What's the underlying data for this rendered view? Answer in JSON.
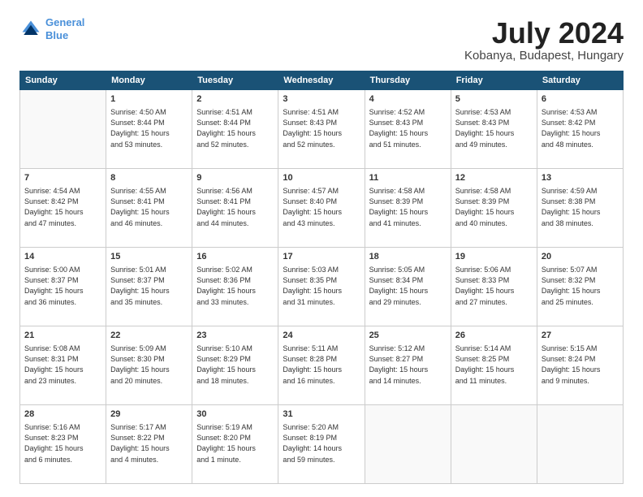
{
  "header": {
    "logo_line1": "General",
    "logo_line2": "Blue",
    "month": "July 2024",
    "location": "Kobanya, Budapest, Hungary"
  },
  "weekdays": [
    "Sunday",
    "Monday",
    "Tuesday",
    "Wednesday",
    "Thursday",
    "Friday",
    "Saturday"
  ],
  "weeks": [
    [
      {
        "day": "",
        "info": ""
      },
      {
        "day": "1",
        "info": "Sunrise: 4:50 AM\nSunset: 8:44 PM\nDaylight: 15 hours\nand 53 minutes."
      },
      {
        "day": "2",
        "info": "Sunrise: 4:51 AM\nSunset: 8:44 PM\nDaylight: 15 hours\nand 52 minutes."
      },
      {
        "day": "3",
        "info": "Sunrise: 4:51 AM\nSunset: 8:43 PM\nDaylight: 15 hours\nand 52 minutes."
      },
      {
        "day": "4",
        "info": "Sunrise: 4:52 AM\nSunset: 8:43 PM\nDaylight: 15 hours\nand 51 minutes."
      },
      {
        "day": "5",
        "info": "Sunrise: 4:53 AM\nSunset: 8:43 PM\nDaylight: 15 hours\nand 49 minutes."
      },
      {
        "day": "6",
        "info": "Sunrise: 4:53 AM\nSunset: 8:42 PM\nDaylight: 15 hours\nand 48 minutes."
      }
    ],
    [
      {
        "day": "7",
        "info": "Sunrise: 4:54 AM\nSunset: 8:42 PM\nDaylight: 15 hours\nand 47 minutes."
      },
      {
        "day": "8",
        "info": "Sunrise: 4:55 AM\nSunset: 8:41 PM\nDaylight: 15 hours\nand 46 minutes."
      },
      {
        "day": "9",
        "info": "Sunrise: 4:56 AM\nSunset: 8:41 PM\nDaylight: 15 hours\nand 44 minutes."
      },
      {
        "day": "10",
        "info": "Sunrise: 4:57 AM\nSunset: 8:40 PM\nDaylight: 15 hours\nand 43 minutes."
      },
      {
        "day": "11",
        "info": "Sunrise: 4:58 AM\nSunset: 8:39 PM\nDaylight: 15 hours\nand 41 minutes."
      },
      {
        "day": "12",
        "info": "Sunrise: 4:58 AM\nSunset: 8:39 PM\nDaylight: 15 hours\nand 40 minutes."
      },
      {
        "day": "13",
        "info": "Sunrise: 4:59 AM\nSunset: 8:38 PM\nDaylight: 15 hours\nand 38 minutes."
      }
    ],
    [
      {
        "day": "14",
        "info": "Sunrise: 5:00 AM\nSunset: 8:37 PM\nDaylight: 15 hours\nand 36 minutes."
      },
      {
        "day": "15",
        "info": "Sunrise: 5:01 AM\nSunset: 8:37 PM\nDaylight: 15 hours\nand 35 minutes."
      },
      {
        "day": "16",
        "info": "Sunrise: 5:02 AM\nSunset: 8:36 PM\nDaylight: 15 hours\nand 33 minutes."
      },
      {
        "day": "17",
        "info": "Sunrise: 5:03 AM\nSunset: 8:35 PM\nDaylight: 15 hours\nand 31 minutes."
      },
      {
        "day": "18",
        "info": "Sunrise: 5:05 AM\nSunset: 8:34 PM\nDaylight: 15 hours\nand 29 minutes."
      },
      {
        "day": "19",
        "info": "Sunrise: 5:06 AM\nSunset: 8:33 PM\nDaylight: 15 hours\nand 27 minutes."
      },
      {
        "day": "20",
        "info": "Sunrise: 5:07 AM\nSunset: 8:32 PM\nDaylight: 15 hours\nand 25 minutes."
      }
    ],
    [
      {
        "day": "21",
        "info": "Sunrise: 5:08 AM\nSunset: 8:31 PM\nDaylight: 15 hours\nand 23 minutes."
      },
      {
        "day": "22",
        "info": "Sunrise: 5:09 AM\nSunset: 8:30 PM\nDaylight: 15 hours\nand 20 minutes."
      },
      {
        "day": "23",
        "info": "Sunrise: 5:10 AM\nSunset: 8:29 PM\nDaylight: 15 hours\nand 18 minutes."
      },
      {
        "day": "24",
        "info": "Sunrise: 5:11 AM\nSunset: 8:28 PM\nDaylight: 15 hours\nand 16 minutes."
      },
      {
        "day": "25",
        "info": "Sunrise: 5:12 AM\nSunset: 8:27 PM\nDaylight: 15 hours\nand 14 minutes."
      },
      {
        "day": "26",
        "info": "Sunrise: 5:14 AM\nSunset: 8:25 PM\nDaylight: 15 hours\nand 11 minutes."
      },
      {
        "day": "27",
        "info": "Sunrise: 5:15 AM\nSunset: 8:24 PM\nDaylight: 15 hours\nand 9 minutes."
      }
    ],
    [
      {
        "day": "28",
        "info": "Sunrise: 5:16 AM\nSunset: 8:23 PM\nDaylight: 15 hours\nand 6 minutes."
      },
      {
        "day": "29",
        "info": "Sunrise: 5:17 AM\nSunset: 8:22 PM\nDaylight: 15 hours\nand 4 minutes."
      },
      {
        "day": "30",
        "info": "Sunrise: 5:19 AM\nSunset: 8:20 PM\nDaylight: 15 hours\nand 1 minute."
      },
      {
        "day": "31",
        "info": "Sunrise: 5:20 AM\nSunset: 8:19 PM\nDaylight: 14 hours\nand 59 minutes."
      },
      {
        "day": "",
        "info": ""
      },
      {
        "day": "",
        "info": ""
      },
      {
        "day": "",
        "info": ""
      }
    ]
  ]
}
